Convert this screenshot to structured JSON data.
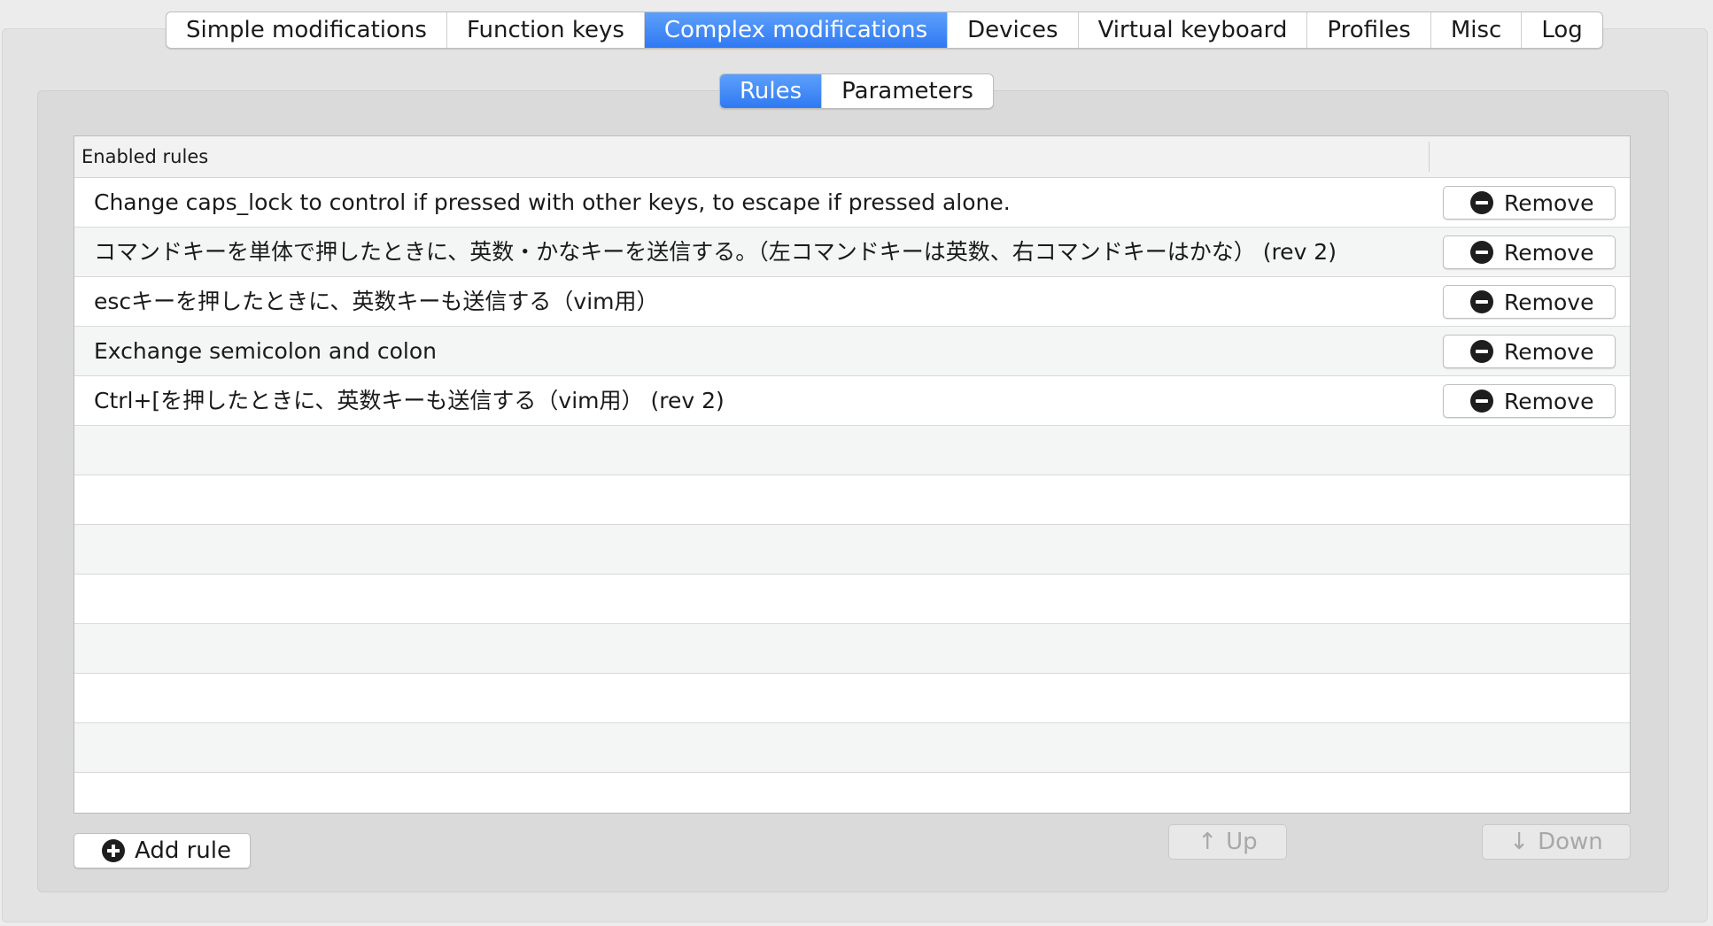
{
  "tabs": [
    {
      "label": "Simple modifications",
      "active": false
    },
    {
      "label": "Function keys",
      "active": false
    },
    {
      "label": "Complex modifications",
      "active": true
    },
    {
      "label": "Devices",
      "active": false
    },
    {
      "label": "Virtual keyboard",
      "active": false
    },
    {
      "label": "Profiles",
      "active": false
    },
    {
      "label": "Misc",
      "active": false
    },
    {
      "label": "Log",
      "active": false
    }
  ],
  "subtabs": [
    {
      "label": "Rules",
      "active": true
    },
    {
      "label": "Parameters",
      "active": false
    }
  ],
  "table": {
    "header": "Enabled rules",
    "rules": [
      "Change caps_lock to control if pressed with other keys, to escape if pressed alone.",
      "コマンドキーを単体で押したときに、英数・かなキーを送信する。（左コマンドキーは英数、右コマンドキーはかな） (rev 2)",
      "escキーを押したときに、英数キーも送信する（vim用）",
      "Exchange semicolon and colon",
      "Ctrl+[を押したときに、英数キーも送信する（vim用） (rev 2)"
    ],
    "remove_label": "Remove",
    "empty_rows": 8
  },
  "actions": {
    "add_rule": "Add rule",
    "up": "Up",
    "down": "Down"
  },
  "icons": {
    "remove": "minus-circle-icon",
    "add": "plus-circle-icon",
    "up": "arrow-up-icon",
    "down": "arrow-down-icon"
  },
  "colors": {
    "active_tab": "#3d86f6",
    "background": "#ececec"
  }
}
